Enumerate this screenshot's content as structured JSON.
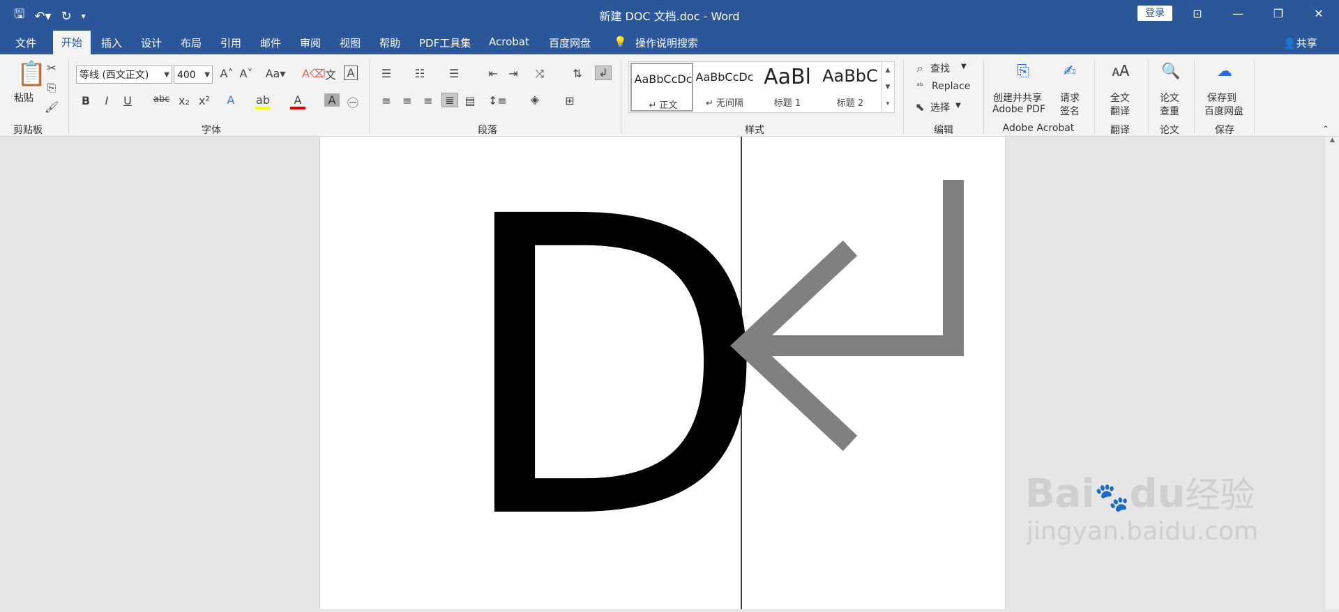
{
  "window": {
    "title": "新建 DOC 文档.doc  -  Word",
    "login": "登录",
    "share": "共享",
    "tell_me": "操作说明搜索"
  },
  "tabs": [
    "文件",
    "开始",
    "插入",
    "设计",
    "布局",
    "引用",
    "邮件",
    "审阅",
    "视图",
    "帮助",
    "PDF工具集",
    "Acrobat",
    "百度网盘"
  ],
  "font": {
    "name": "等线 (西文正文)",
    "size": "400"
  },
  "clipboard": {
    "paste": "粘贴",
    "label": "剪贴板"
  },
  "groups": {
    "font": "字体",
    "paragraph": "段落",
    "styles": "样式",
    "editing": "编辑",
    "acrobat": "Adobe Acrobat",
    "translate": "翻译",
    "paper": "论文",
    "save": "保存"
  },
  "styles": [
    {
      "sample": "AaBbCcDc",
      "name": "↵ 正文"
    },
    {
      "sample": "AaBbCcDc",
      "name": "↵ 无间隔"
    },
    {
      "sample": "AaBl",
      "name": "标题 1"
    },
    {
      "sample": "AaBbC",
      "name": "标题 2"
    }
  ],
  "editing": {
    "find": "查找",
    "replace": "Replace",
    "select": "选择"
  },
  "acrobat": {
    "create1": "创建并共享",
    "create2": "Adobe PDF",
    "sign1": "请求",
    "sign2": "签名"
  },
  "translate": {
    "l1": "全文",
    "l2": "翻译"
  },
  "paper": {
    "l1": "论文",
    "l2": "查重"
  },
  "save": {
    "l1": "保存到",
    "l2": "百度网盘"
  },
  "document": {
    "glyph": "D"
  },
  "watermark": {
    "brand": "Bai",
    "brand2": "du",
    "tagline": "经验",
    "url": "jingyan.baidu.com"
  }
}
